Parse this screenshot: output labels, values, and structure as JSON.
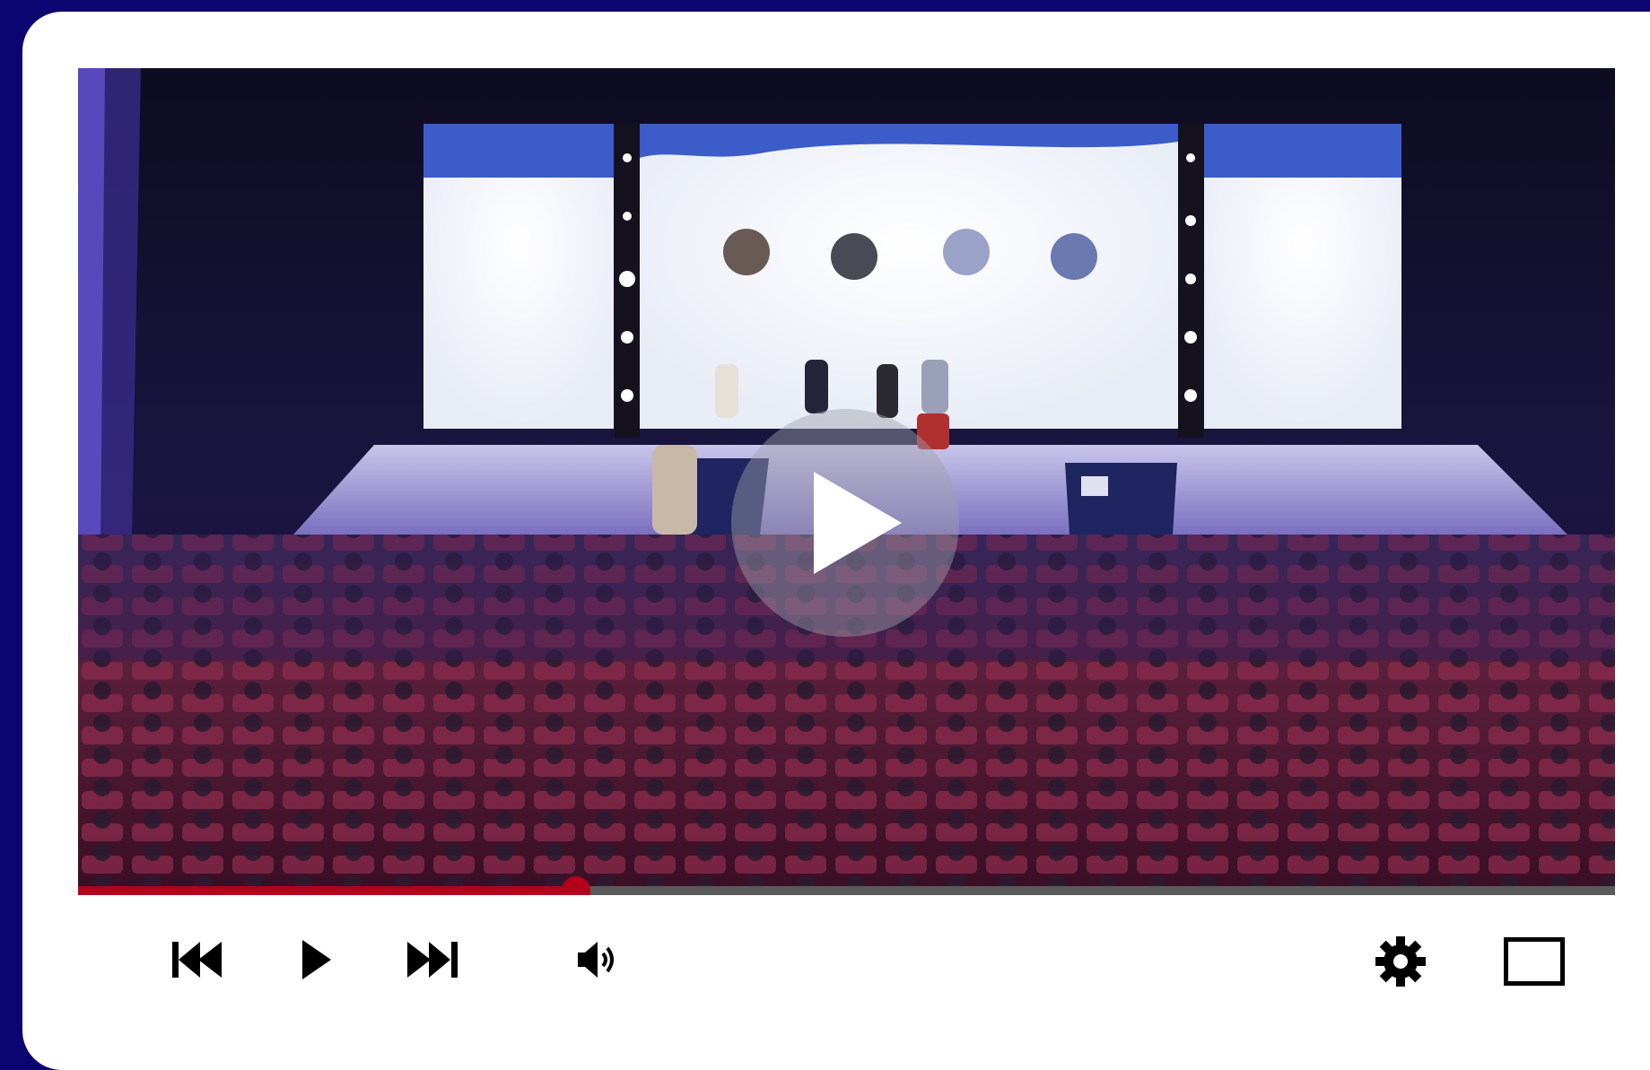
{
  "player": {
    "progress_fraction": 0.324,
    "colors": {
      "page_background": "#0c0470",
      "card_background": "#ffffff",
      "progress_played": "#b3001b",
      "progress_buffer": "#5a5a5a",
      "icon": "#000000"
    }
  },
  "icons": {
    "big_play": "play-icon",
    "previous": "skip-previous-icon",
    "play": "play-icon",
    "next": "skip-next-icon",
    "volume": "volume-icon",
    "settings": "gear-icon",
    "fullscreen": "fullscreen-icon"
  }
}
